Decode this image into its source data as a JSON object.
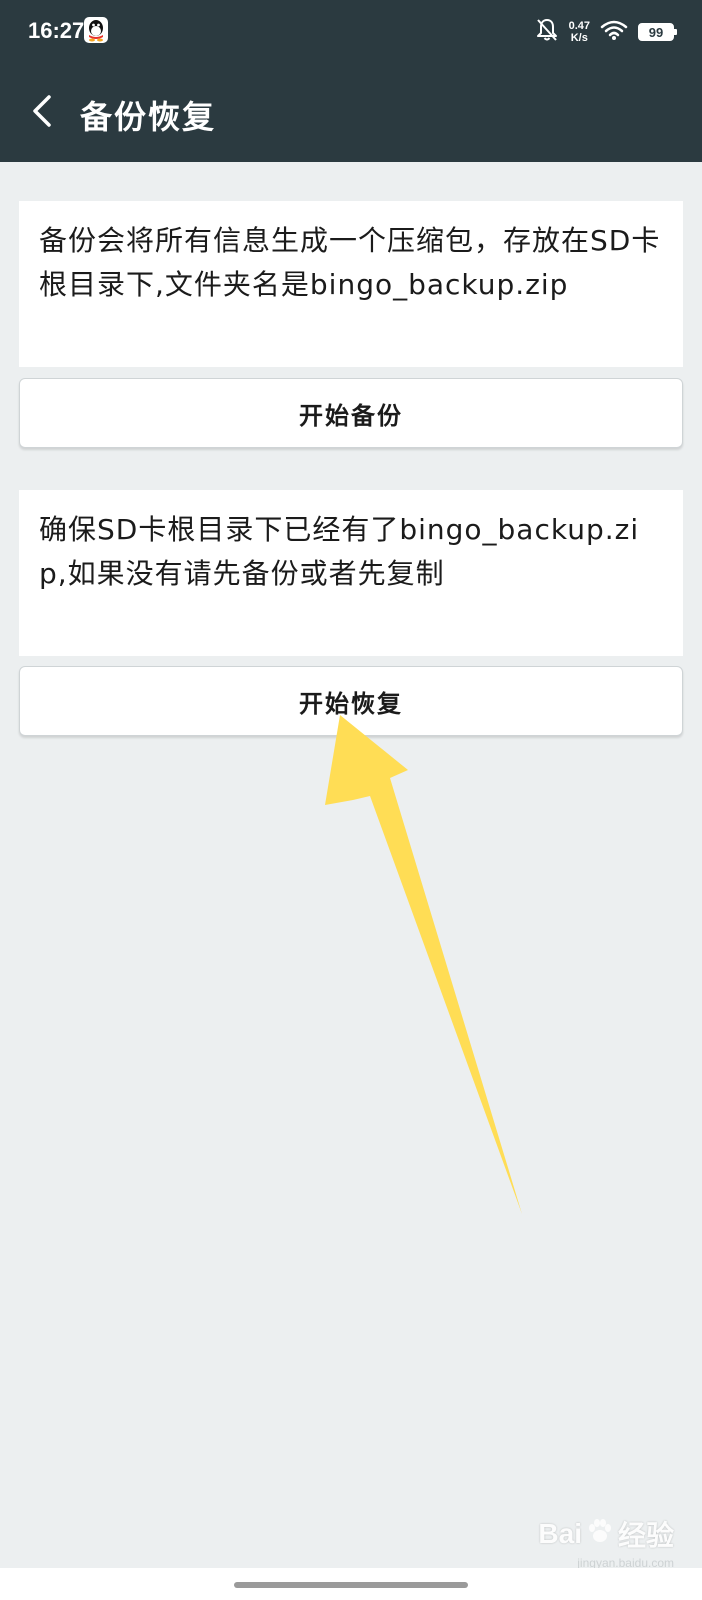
{
  "status_bar": {
    "time": "16:27",
    "net_speed_value": "0.47",
    "net_speed_unit": "K/s",
    "battery": "99",
    "icons": [
      "qq-icon",
      "bell-off-icon",
      "wifi-icon",
      "battery-icon"
    ]
  },
  "app_bar": {
    "title": "备份恢复",
    "back_icon": "chevron-left-icon"
  },
  "backup_section": {
    "description": "备份会将所有信息生成一个压缩包，存放在SD卡根目录下,文件夹名是bingo_backup.zip",
    "button_label": "开始备份"
  },
  "restore_section": {
    "description": "确保SD卡根目录下已经有了bingo_backup.zip,如果没有请先备份或者先复制",
    "button_label": "开始恢复"
  },
  "annotation": {
    "arrow_color": "#FFDD55"
  },
  "watermark": {
    "brand_left": "Bai",
    "brand_right": "经验",
    "url": "jingyan.baidu.com"
  },
  "colors": {
    "header_bg": "#2B3A40",
    "page_bg": "#ECEFF0",
    "card_bg": "#FFFFFF"
  }
}
